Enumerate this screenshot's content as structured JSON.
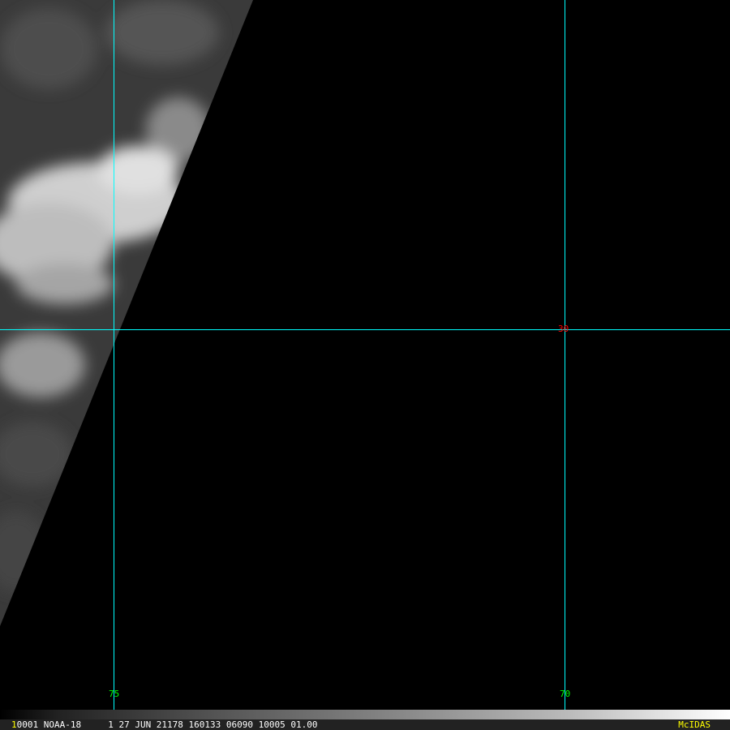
{
  "image": {
    "satellite": "NOAA-18",
    "info_line": "0001 NOAA-18     1 27 JUN 21178 160133 06090 10005 01.00",
    "frame_marker": "1",
    "brand": "McIDAS"
  },
  "grid": {
    "latitude_labels": [
      "30"
    ],
    "longitude_labels": [
      "75",
      "70"
    ]
  },
  "colors": {
    "grid_line": "#00ffff",
    "lat_label": "#ff0000",
    "lon_label": "#00ff00",
    "brand": "#ffff00"
  }
}
